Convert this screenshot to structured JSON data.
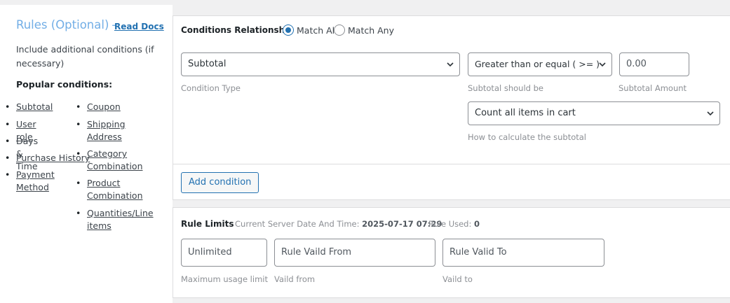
{
  "sidebar": {
    "title": "Rules (Optional)",
    "dash": "-",
    "read_docs": "Read Docs",
    "description": "Include additional conditions (if necessary)",
    "popular_heading": "Popular conditions:",
    "left_items": [
      {
        "label": "Subtotal",
        "link": true
      },
      {
        "label": "User role",
        "link": true
      },
      {
        "label": "Days & Time",
        "link": false
      },
      {
        "label": "Purchase History",
        "link": true
      },
      {
        "label": "Payment Method",
        "link": true
      }
    ],
    "right_items": [
      {
        "label": "Coupon",
        "link": true
      },
      {
        "label": "Shipping Address",
        "link": true
      },
      {
        "label": "Category Combination",
        "link": true
      },
      {
        "label": "Product Combination",
        "link": true
      },
      {
        "label": "Quantities/Line items",
        "link": true
      }
    ]
  },
  "conditions": {
    "relationship_label": "Conditions Relationship",
    "match_all": "Match All",
    "match_any": "Match Any",
    "selected": "Match All",
    "condition_type_value": "Subtotal",
    "condition_type_hint": "Condition Type",
    "operator_value": "Greater than or equal ( >= )",
    "operator_hint": "Subtotal should be",
    "amount_value": "0.00",
    "amount_hint": "Subtotal Amount",
    "calc_value": "Count all items in cart",
    "calc_hint": "How to calculate the subtotal",
    "add_button": "Add condition"
  },
  "limits": {
    "label": "Rule Limits",
    "server_time_label": "Current Server Date And Time:",
    "server_time_value": "2025-07-17 07:29",
    "rule_used_label": "Rule Used:",
    "rule_used_value": "0",
    "max_usage_placeholder": "Unlimited",
    "max_usage_hint": "Maximum usage limit",
    "valid_from_placeholder": "Rule Vaild From",
    "valid_from_hint": "Vaild from",
    "valid_to_placeholder": "Rule Valid To",
    "valid_to_hint": "Vaild to"
  }
}
